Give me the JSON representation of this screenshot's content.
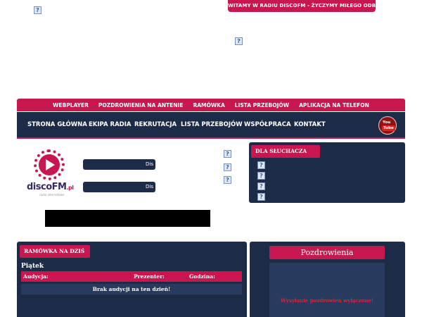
{
  "welcome_banner": "WITAMY W RADIU DISCOFM - ŻYCZYMY MIŁEGO ODBIORU!",
  "top_nav": [
    "WEBPLAYER",
    "POZDROWIENIA NA ANTENIE",
    "RAMÓWKA",
    "LISTA PRZEBOJÓW",
    "APLIKACJA NA TELEFON"
  ],
  "main_nav": [
    "STRONA GŁÓWNA",
    "EKIPA RADIA",
    "REKRUTACJA",
    "LISTA PRZEBOJÓW",
    "WSPÓŁPRACA",
    "KONTAKT"
  ],
  "youtube": {
    "you": "You",
    "tube": "Tube"
  },
  "logo": {
    "name": "discoFM",
    "suffix": ".pl",
    "tagline": "radio internetowe"
  },
  "players": [
    "Dis",
    "Dis"
  ],
  "broken_icon_glyph": "?",
  "side_panel": {
    "title": "DLA SŁUCHACZA"
  },
  "schedule": {
    "title": "RAMÓWKA NA DZIŚ",
    "day": "Piątek",
    "columns": [
      "Audycja:",
      "Prezenter:",
      "Godzina:"
    ],
    "empty_message": "Brak audycji na ten dzień!"
  },
  "greetings": {
    "title": "Pozdrowienia",
    "message": "Wysyłanie pozdrowień wyłączone!"
  },
  "colors": {
    "accent": "#c8174e",
    "navy": "#1c2c47",
    "navy_light": "#283b5e",
    "alert": "#e0203a"
  }
}
